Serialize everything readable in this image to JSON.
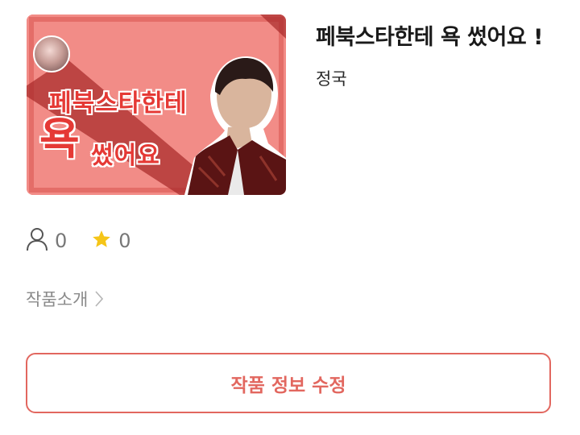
{
  "work": {
    "title": "페북스타한테 욕 썼어요 !",
    "author": "정국",
    "cover": {
      "line1": "페북스타한테",
      "big": "욕",
      "line2": "썼어요"
    }
  },
  "stats": {
    "readers": "0",
    "stars": "0"
  },
  "intro": {
    "label": "작품소개"
  },
  "edit_button": {
    "label": "작품 정보 수정"
  },
  "colors": {
    "accent": "#e2675f",
    "star": "#f5c518",
    "cover_bg": "#f28c87",
    "cover_text": "#e53935"
  },
  "icons": {
    "readers": "person-icon",
    "stars": "star-icon",
    "intro": "chevron-right-icon"
  }
}
